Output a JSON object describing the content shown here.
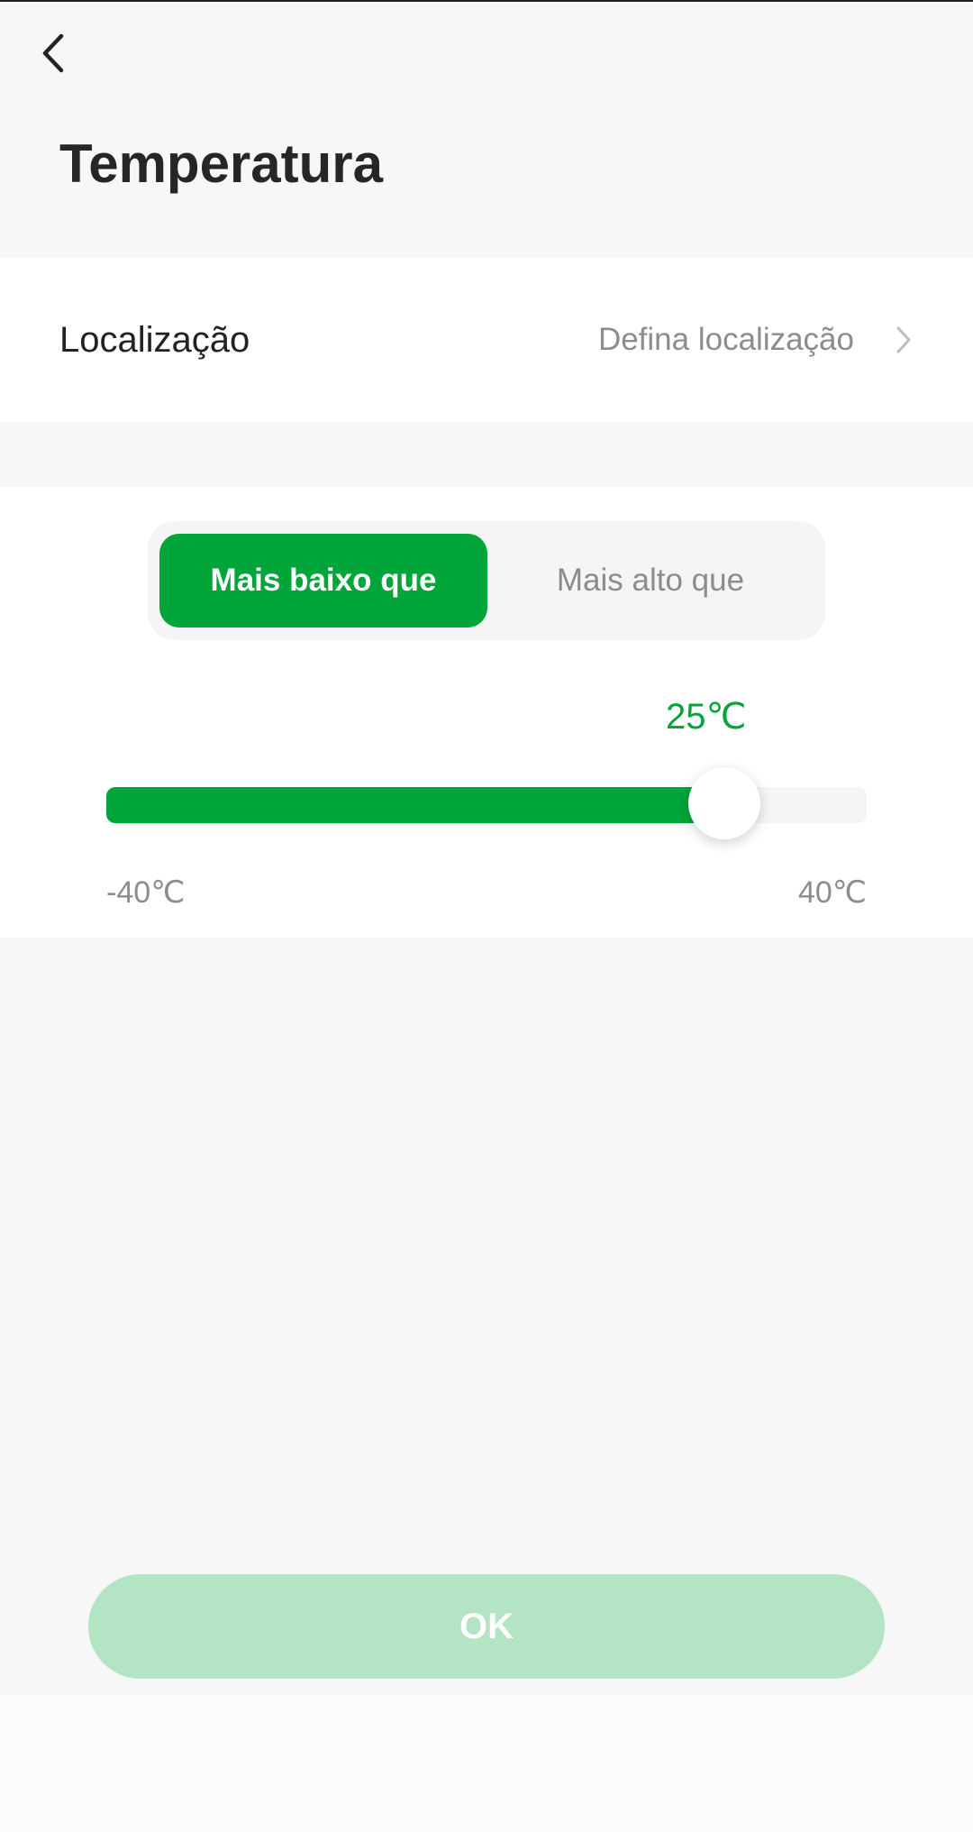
{
  "header": {
    "title": "Temperatura",
    "back_icon": "chevron-left-icon"
  },
  "location": {
    "label": "Localização",
    "value": "Defina localização",
    "chevron_icon": "chevron-right-icon"
  },
  "mode": {
    "options": [
      "Mais baixo que",
      "Mais alto que"
    ],
    "selected_index": 0
  },
  "slider": {
    "value_label": "25℃",
    "value": 25,
    "min": -40,
    "max": 40,
    "min_label": "-40℃",
    "max_label": "40℃"
  },
  "actions": {
    "ok_label": "OK"
  },
  "colors": {
    "accent": "#02a53a",
    "accent_disabled": "#b3e4c4",
    "muted_text": "#8c8c8c",
    "track": "#f5f5f5"
  }
}
